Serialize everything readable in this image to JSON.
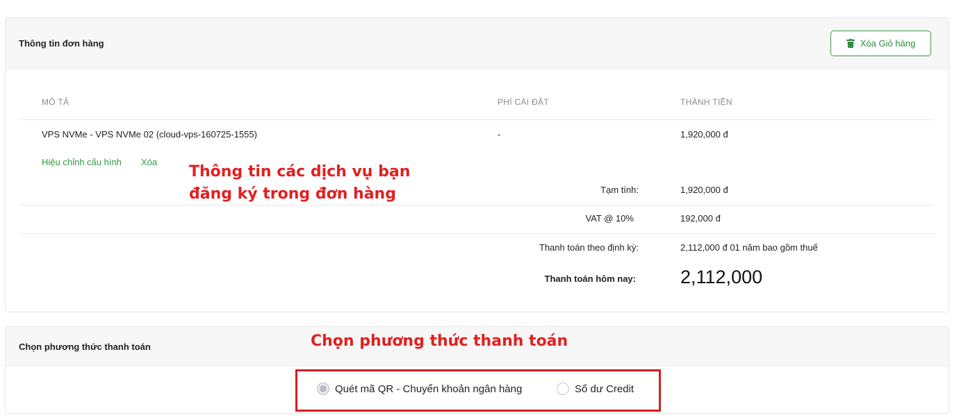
{
  "order": {
    "title": "Thông tin đơn hàng",
    "clear_cart_label": "Xóa Giỏ hàng",
    "columns": {
      "description": "MÔ TẢ",
      "setup_fee": "PHÍ CÀI ĐẶT",
      "amount": "THÀNH TIỀN"
    },
    "item": {
      "description": "VPS NVMe - VPS NVMe 02 (cloud-vps-160725-1555)",
      "setup_fee": "-",
      "amount": "1,920,000 đ",
      "edit_link": "Hiệu chỉnh cấu hình",
      "delete_link": "Xóa"
    },
    "totals": {
      "subtotal_label": "Tạm tính:",
      "subtotal_value": "1,920,000 đ",
      "vat_label": "VAT @ 10%",
      "vat_value": "192,000 đ",
      "recurring_label": "Thanh toán theo định kỳ:",
      "recurring_value": "2,112,000 đ 01 năm bao gồm thuế",
      "today_label": "Thanh toán hôm nay:",
      "today_value": "2,112,000"
    }
  },
  "annotations": {
    "order_note_line1": "Thông tin các dịch vụ bạn",
    "order_note_line2": "đăng ký trong đơn hàng",
    "payment_note": "Chọn phương thức thanh toán"
  },
  "payment": {
    "title": "Chọn phương thức thanh toán",
    "options": [
      {
        "label": "Quét mã QR - Chuyển khoản ngân hàng",
        "selected": true
      },
      {
        "label": "Số dư Credit",
        "selected": false
      }
    ]
  },
  "colors": {
    "accent_green": "#2f9a3f",
    "annotation_red": "#e02020"
  }
}
